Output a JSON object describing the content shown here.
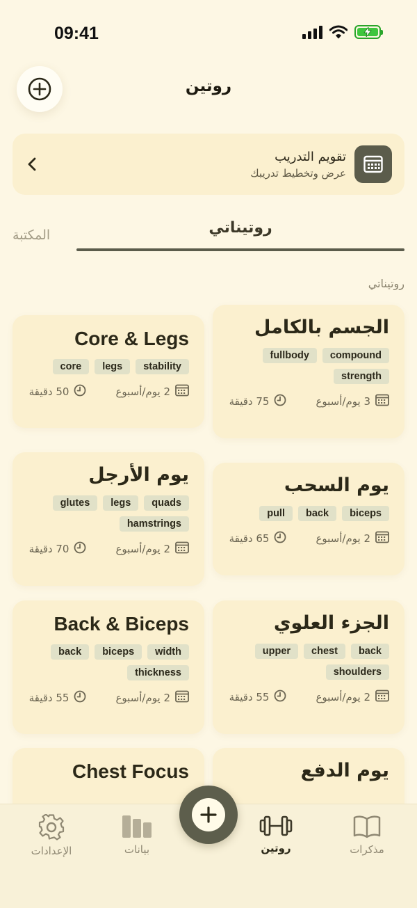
{
  "status_bar": {
    "time": "09:41"
  },
  "header": {
    "title": "روتين"
  },
  "calendar": {
    "title": "تقويم التدريب",
    "subtitle": "عرض وتخطيط تدريبك"
  },
  "tabs": {
    "routines": "روتيناتي",
    "library": "المكتبة"
  },
  "section_label": "روتيناتي",
  "routines": [
    {
      "title": "الجسم بالكامل",
      "tags": [
        "compound",
        "fullbody",
        "strength"
      ],
      "frequency": "3 يوم/أسبوع",
      "duration": "75 دقيقة"
    },
    {
      "title": "Core & Legs",
      "tags": [
        "stability",
        "legs",
        "core"
      ],
      "frequency": "2 يوم/أسبوع",
      "duration": "50 دقيقة"
    },
    {
      "title": "يوم السحب",
      "tags": [
        "biceps",
        "back",
        "pull"
      ],
      "frequency": "2 يوم/أسبوع",
      "duration": "65 دقيقة"
    },
    {
      "title": "يوم الأرجل",
      "tags": [
        "quads",
        "legs",
        "glutes",
        "hamstrings"
      ],
      "frequency": "2 يوم/أسبوع",
      "duration": "70 دقيقة"
    },
    {
      "title": "الجزء العلوي",
      "tags": [
        "back",
        "chest",
        "upper",
        "shoulders"
      ],
      "frequency": "2 يوم/أسبوع",
      "duration": "55 دقيقة"
    },
    {
      "title": "Back & Biceps",
      "tags": [
        "width",
        "biceps",
        "back",
        "thickness"
      ],
      "frequency": "2 يوم/أسبوع",
      "duration": "55 دقيقة"
    },
    {
      "title": "يوم الدفع",
      "tags": [],
      "frequency": "",
      "duration": ""
    },
    {
      "title": "Chest Focus",
      "tags": [],
      "frequency": "",
      "duration": ""
    }
  ],
  "bottom_nav": {
    "notes": "مذكرات",
    "routine": "روتين",
    "stats": "بيانات",
    "settings": "الإعدادات"
  }
}
